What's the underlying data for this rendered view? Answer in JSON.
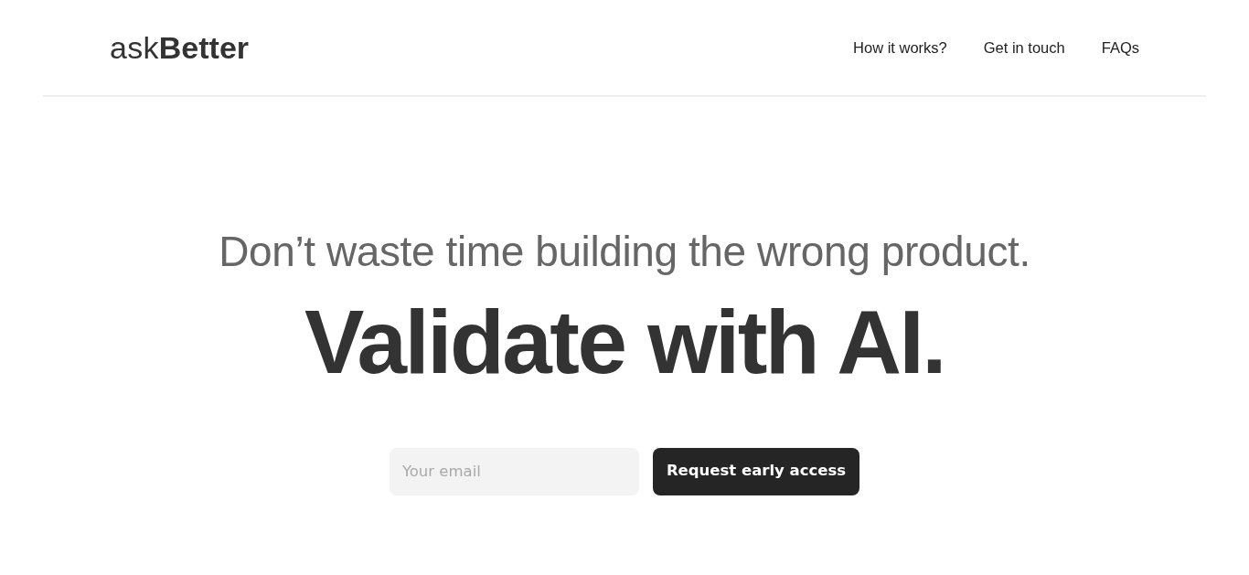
{
  "header": {
    "logo": "ask**Better**",
    "nav": [
      {
        "label": "How it works?"
      },
      {
        "label": "Get in touch"
      },
      {
        "label": "FAQs"
      }
    ]
  },
  "hero": {
    "tagline": "Don’t waste time building the wrong product.",
    "headline": "Validate with AI.",
    "email_field": {
      "placeholder": "Your email"
    },
    "submit_button": "Request early access"
  }
}
